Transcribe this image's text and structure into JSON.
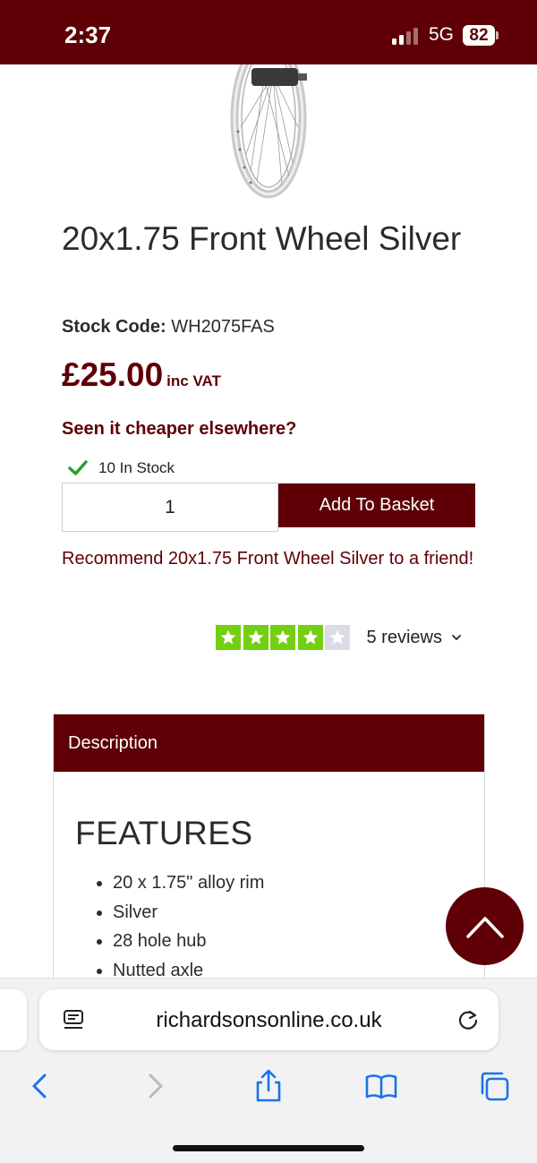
{
  "status_bar": {
    "time": "2:37",
    "network": "5G",
    "battery": "82",
    "background_color": "#5e0005"
  },
  "product": {
    "image_icon": "wheel-image",
    "title": "20x1.75 Front Wheel Silver",
    "stock_code_label": "Stock Code:",
    "stock_code_value": "WH2075FAS",
    "price": "£25.00",
    "price_suffix": "inc VAT",
    "cheaper_link": "Seen it cheaper elsewhere?",
    "stock_status": "10 In Stock",
    "quantity": "1",
    "add_to_basket": "Add To Basket",
    "recommend_link": "Recommend 20x1.75 Front Wheel Silver to a friend!"
  },
  "rating": {
    "stars": 4,
    "max_stars": 5,
    "reviews_label": "5 reviews",
    "star_color": "#73cf11",
    "empty_star_color": "#dcdce6"
  },
  "description": {
    "tab_label": "Description",
    "features_heading": "FEATURES",
    "features": [
      "20 x 1.75\" alloy rim",
      "Silver",
      "28 hole hub",
      "Nutted axle"
    ]
  },
  "browser": {
    "url": "richardsonsonline.co.uk",
    "icons": [
      "reader-icon",
      "reload-icon",
      "back-icon",
      "forward-icon",
      "share-icon",
      "bookmarks-icon",
      "tabs-icon"
    ]
  },
  "accent_color": "#5e0005"
}
